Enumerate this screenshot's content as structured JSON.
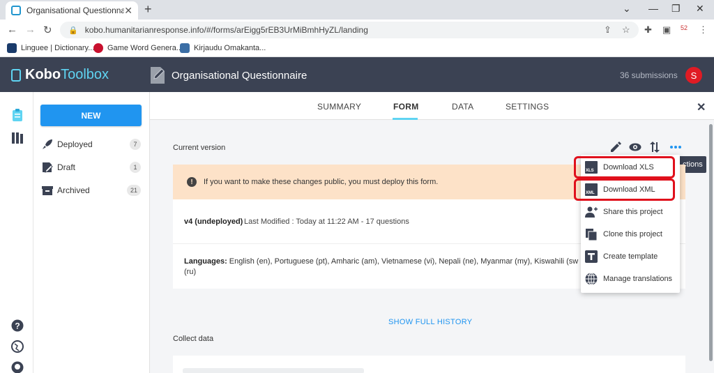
{
  "browser": {
    "tab_title": "Organisational Questionnaire | K",
    "tab_close": "✕",
    "new_tab": "+",
    "url": "kobo.humanitarianresponse.info/#/forms/arEigg5rEB3UrMiBmhHyZL/landing",
    "bookmarks": [
      {
        "label": "Linguee | Dictionary...",
        "color": "#1a3b6b"
      },
      {
        "label": "Game Word Genera...",
        "color": "#c8102e"
      },
      {
        "label": "Kirjaudu Omakanta...",
        "color": "#3b6ea5"
      }
    ]
  },
  "header": {
    "logo_bold": "Kobo",
    "logo_light": "Toolbox",
    "title": "Organisational Questionnaire",
    "submissions": "36 submissions",
    "avatar_letter": "S",
    "avatar_color": "#e01b24"
  },
  "sidebar": {
    "new_label": "NEW",
    "items": [
      {
        "label": "Deployed",
        "count": "7",
        "icon": "rocket-icon"
      },
      {
        "label": "Draft",
        "count": "1",
        "icon": "draft-form-icon"
      },
      {
        "label": "Archived",
        "count": "21",
        "icon": "archive-box-icon"
      }
    ]
  },
  "tabs": [
    {
      "label": "SUMMARY",
      "active": false
    },
    {
      "label": "FORM",
      "active": true
    },
    {
      "label": "DATA",
      "active": false
    },
    {
      "label": "SETTINGS",
      "active": false
    }
  ],
  "main": {
    "current_version_label": "Current version",
    "tooltip": "ctions",
    "warning": "If you want to make these changes public, you must deploy this form.",
    "version_name": "v4 (undeployed)",
    "last_modified": "Last Modified : Today at 11:22 AM - 17 questions",
    "languages_label": "Languages:",
    "languages_line1": "English (en), Portuguese (pt), Amharic (am), Vietnamese (vi), Nepali (ne), Myanmar (my), Kiswahili (sw",
    "languages_line2": "(ru)",
    "show_history": "SHOW FULL HISTORY",
    "collect_data": "Collect data"
  },
  "dropdown": {
    "items": [
      {
        "label": "Download XLS",
        "icon": "xls-file-icon",
        "badge": "XLS",
        "highlighted": true
      },
      {
        "label": "Download XML",
        "icon": "xml-file-icon",
        "badge": "XML",
        "highlighted": true
      },
      {
        "label": "Share this project",
        "icon": "add-person-icon"
      },
      {
        "label": "Clone this project",
        "icon": "clone-icon"
      },
      {
        "label": "Create template",
        "icon": "template-icon"
      },
      {
        "label": "Manage translations",
        "icon": "globe-icon"
      }
    ]
  },
  "colors": {
    "accent": "#2095f0",
    "header_bg": "#3b4253",
    "tab_underline": "#5fd4f2",
    "warning_bg": "#fde2c8",
    "highlight": "#e0101c"
  }
}
